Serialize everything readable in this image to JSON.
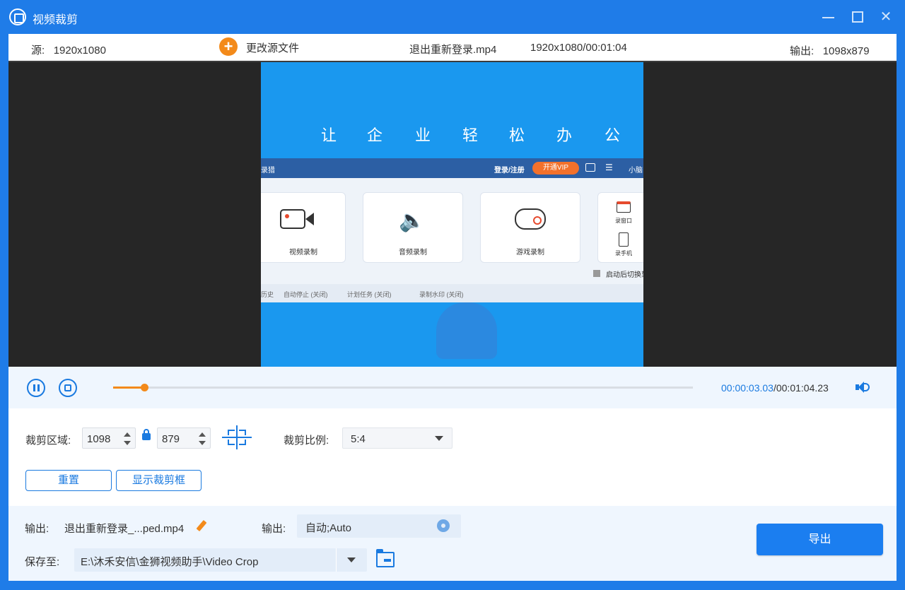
{
  "window": {
    "title": "视频裁剪"
  },
  "infobar": {
    "source_label": "源:",
    "source_size": "1920x1080",
    "change_source": "更改源文件",
    "file_name": "退出重新登录.mp4",
    "file_meta": "1920x1080/00:01:04",
    "output_label": "输出:",
    "output_size": "1098x879"
  },
  "preview": {
    "headline_chars": [
      "让",
      "企",
      "业",
      "轻",
      "松",
      "办",
      "公"
    ],
    "app_topbar": {
      "title": "录猎",
      "login": "登录/注册",
      "vip": "开通VIP",
      "user": "小脑"
    },
    "cards": [
      {
        "label": "视频录制",
        "icon": "camera-icon"
      },
      {
        "label": "音频录制",
        "icon": "speaker-icon"
      },
      {
        "label": "游戏录制",
        "icon": "gamepad-icon"
      }
    ],
    "side_items": [
      "录窗口",
      "录手机"
    ],
    "checkbox_label": "启动后切换到",
    "status_items": [
      "历史",
      "自动停止 (关闭)",
      "计划任务 (关闭)",
      "录制水印 (关闭)"
    ]
  },
  "playback": {
    "progress": 0.054,
    "time_current": "00:00:03.03",
    "time_total": "/00:01:04.23"
  },
  "crop": {
    "area_label": "裁剪区域:",
    "width": "1098",
    "height": "879",
    "ratio_label": "裁剪比例:",
    "ratio_value": "5:4",
    "reset_label": "重置",
    "show_frame_label": "显示裁剪框"
  },
  "output": {
    "name_label": "输出:",
    "name_value": "退出重新登录_...ped.mp4",
    "format_label": "输出:",
    "format_value": "自动;Auto",
    "save_label": "保存至:",
    "save_path": "E:\\沐禾安信\\金狮视频助手\\Video Crop",
    "export_label": "导出"
  },
  "colors": {
    "accent": "#1a7ae0",
    "titlebar": "#1f7ce8",
    "orange": "#f38a1a"
  }
}
